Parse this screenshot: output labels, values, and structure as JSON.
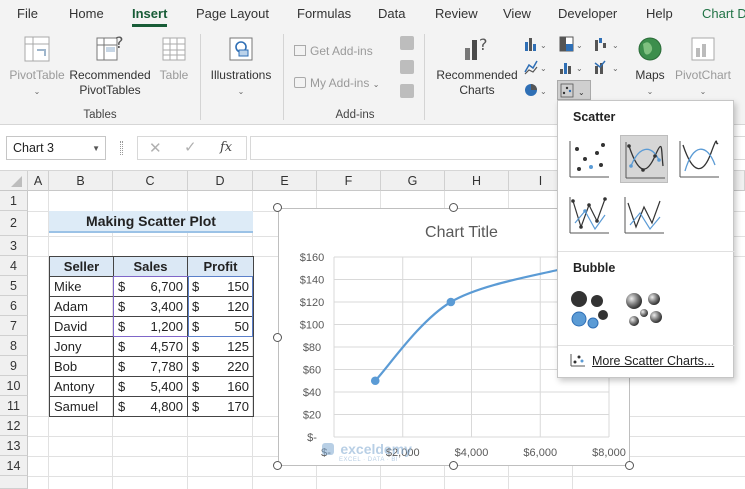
{
  "menu": {
    "tabs": [
      "File",
      "Home",
      "Insert",
      "Page Layout",
      "Formulas",
      "Data",
      "Review",
      "View",
      "Developer",
      "Help",
      "Chart D"
    ],
    "active": "Insert"
  },
  "ribbon": {
    "pivottable": "PivotTable",
    "recommended_pivot_1": "Recommended",
    "recommended_pivot_2": "PivotTables",
    "table": "Table",
    "tables_group": "Tables",
    "illustrations": "Illustrations",
    "get_addins": "Get Add-ins",
    "my_addins": "My Add-ins",
    "addins_group": "Add-ins",
    "recommended_charts_1": "Recommended",
    "recommended_charts_2": "Charts",
    "maps": "Maps",
    "pivotchart": "PivotChart"
  },
  "formula_bar": {
    "name_box": "Chart 3",
    "fx": "fx"
  },
  "sheet": {
    "columns": [
      "A",
      "B",
      "C",
      "D",
      "E",
      "F",
      "G",
      "H",
      "I"
    ],
    "rows": [
      "1",
      "2",
      "3",
      "4",
      "5",
      "6",
      "7",
      "8",
      "9",
      "10",
      "11",
      "12",
      "13",
      "14"
    ],
    "title": "Making Scatter Plot",
    "headers": [
      "Seller",
      "Sales",
      "Profit"
    ],
    "data": [
      {
        "seller": "Mike",
        "sales": "6,700",
        "profit": "150"
      },
      {
        "seller": "Adam",
        "sales": "3,400",
        "profit": "120"
      },
      {
        "seller": "David",
        "sales": "1,200",
        "profit": "50"
      },
      {
        "seller": "Jony",
        "sales": "4,570",
        "profit": "125"
      },
      {
        "seller": "Bob",
        "sales": "7,780",
        "profit": "220"
      },
      {
        "seller": "Antony",
        "sales": "5,400",
        "profit": "160"
      },
      {
        "seller": "Samuel",
        "sales": "4,800",
        "profit": "170"
      }
    ],
    "currency": "$"
  },
  "chart_data": {
    "type": "scatter",
    "title": "Chart Title",
    "x": [
      1200,
      3400,
      6700
    ],
    "y": [
      50,
      120,
      150
    ],
    "xlim": [
      0,
      8000
    ],
    "ylim": [
      0,
      160
    ],
    "x_ticks": [
      "$-",
      "$2,000",
      "$4,000",
      "$6,000",
      "$8,000"
    ],
    "y_ticks": [
      "$-",
      "$20",
      "$40",
      "$60",
      "$80",
      "$100",
      "$120",
      "$140",
      "$160"
    ],
    "grid": true,
    "smooth": true,
    "color": "#5b9bd5"
  },
  "watermark": {
    "name": "exceldemy",
    "tagline": "EXCEL · DATA · BI"
  },
  "scatter_menu": {
    "scatter_heading": "Scatter",
    "bubble_heading": "Bubble",
    "more": "More Scatter Charts..."
  },
  "colors": {
    "accent": "#185c37",
    "series": "#5b9bd5",
    "header_fill": "#dbe8f5"
  }
}
